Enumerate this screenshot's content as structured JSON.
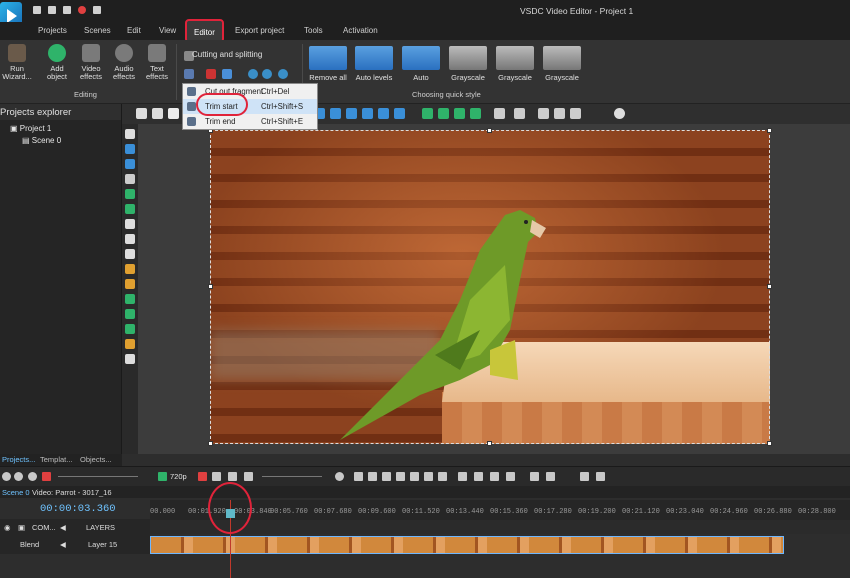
{
  "app_title": "VSDC Video Editor - Project 1",
  "menu_tabs": [
    "Projects",
    "Scenes",
    "Edit",
    "View",
    "Editor",
    "Export project",
    "Tools",
    "Activation"
  ],
  "active_tab": "Editor",
  "ribbon": {
    "run_wizard": "Run\nWizard...",
    "add_object": "Add\nobject",
    "video_effects": "Video\neffects",
    "audio_effects": "Audio\neffects",
    "text_effects": "Text\neffects",
    "editing_label": "Editing",
    "cutting_label": "Cutting and splitting",
    "quick_styles": [
      "Remove all",
      "Auto levels",
      "Auto",
      "Grayscale",
      "Grayscale",
      "Grayscale"
    ],
    "quick_style_label": "Choosing quick style"
  },
  "dropdown": {
    "items": [
      {
        "label": "Cut out fragment",
        "shortcut": "Ctrl+Del"
      },
      {
        "label": "Trim start",
        "shortcut": "Ctrl+Shift+S"
      },
      {
        "label": "Trim end",
        "shortcut": "Ctrl+Shift+E"
      }
    ]
  },
  "explorer": {
    "title": "Projects explorer",
    "project": "Project 1",
    "scene": "Scene 0"
  },
  "panel_tabs": [
    "Projects...",
    "Templat...",
    "Objects..."
  ],
  "playbar": {
    "quality": "720p"
  },
  "timeline": {
    "scene_tab": "Scene 0",
    "video_tab": "Video: Parrot - 3017_16",
    "timecode": "00:00:03.360",
    "ruler_ticks": [
      "00.000",
      "00:01.920",
      "00:03.840",
      "00:05.760",
      "00:07.680",
      "00:09.600",
      "00:11.520",
      "00:13.440",
      "00:15.360",
      "00:17.280",
      "00:19.200",
      "00:21.120",
      "00:23.040",
      "00:24.960",
      "00:26.880",
      "00:28.800"
    ],
    "com_label": "COM...",
    "layers_label": "LAYERS",
    "blend_label": "Blend",
    "layer_name": "Layer 15"
  },
  "colors": {
    "accent_red": "#e0233a",
    "timecode_blue": "#6fc3ff"
  }
}
